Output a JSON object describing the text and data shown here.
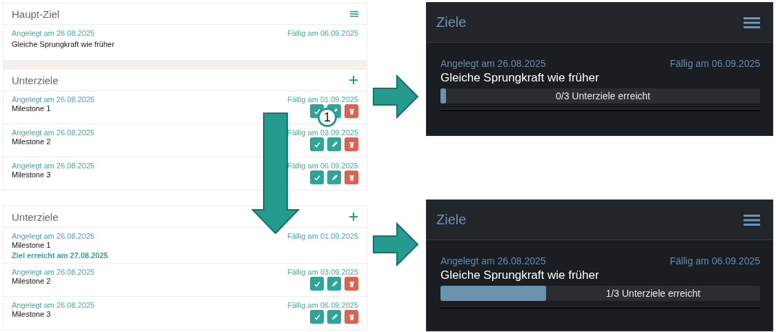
{
  "main_goal_card": {
    "title": "Haupt-Ziel",
    "created": "Angelegt am 26.08.2025",
    "due": "Fällig am 06.09.2025",
    "name": "Gleiche Sprungkraft wie früher"
  },
  "subgoal_panels": [
    {
      "title": "Unterziele",
      "milestones": [
        {
          "created": "Angelegt am 26.08.2025",
          "due": "Fällig am 01.09.2025",
          "name": "Milestone 1",
          "achieved": false
        },
        {
          "created": "Angelegt am 26.08.2025",
          "due": "Fällig am 03.09.2025",
          "name": "Milestone 2",
          "achieved": false
        },
        {
          "created": "Angelegt am 26.08.2025",
          "due": "Fällig am 06.09.2025",
          "name": "Milestone 3",
          "achieved": false
        }
      ]
    },
    {
      "title": "Unterziele",
      "milestones": [
        {
          "created": "Angelegt am 26.08.2025",
          "due": "Fällig am 01.09.2025",
          "name": "Milestone 1",
          "achieved": true,
          "achieved_note": "Ziel erreicht am 27.08.2025"
        },
        {
          "created": "Angelegt am 26.08.2025",
          "due": "Fällig am 03.09.2025",
          "name": "Milestone 2",
          "achieved": false
        },
        {
          "created": "Angelegt am 26.08.2025",
          "due": "Fällig am 06.09.2025",
          "name": "Milestone 3",
          "achieved": false
        }
      ]
    }
  ],
  "goal_widgets": [
    {
      "title": "Ziele",
      "created": "Angelegt am 26.08.2025",
      "due": "Fällig am 06.09.2025",
      "name": "Gleiche Sprungkraft wie früher",
      "progress": {
        "level": 0,
        "label": "0/3 Unterziele erreicht"
      }
    },
    {
      "title": "Ziele",
      "created": "Angelegt am 26.08.2025",
      "due": "Fällig am 06.09.2025",
      "name": "Gleiche Sprungkraft wie früher",
      "progress": {
        "level": 0.33,
        "label": "1/3 Unterziele erreicht"
      }
    }
  ],
  "callout": {
    "label": "1"
  }
}
